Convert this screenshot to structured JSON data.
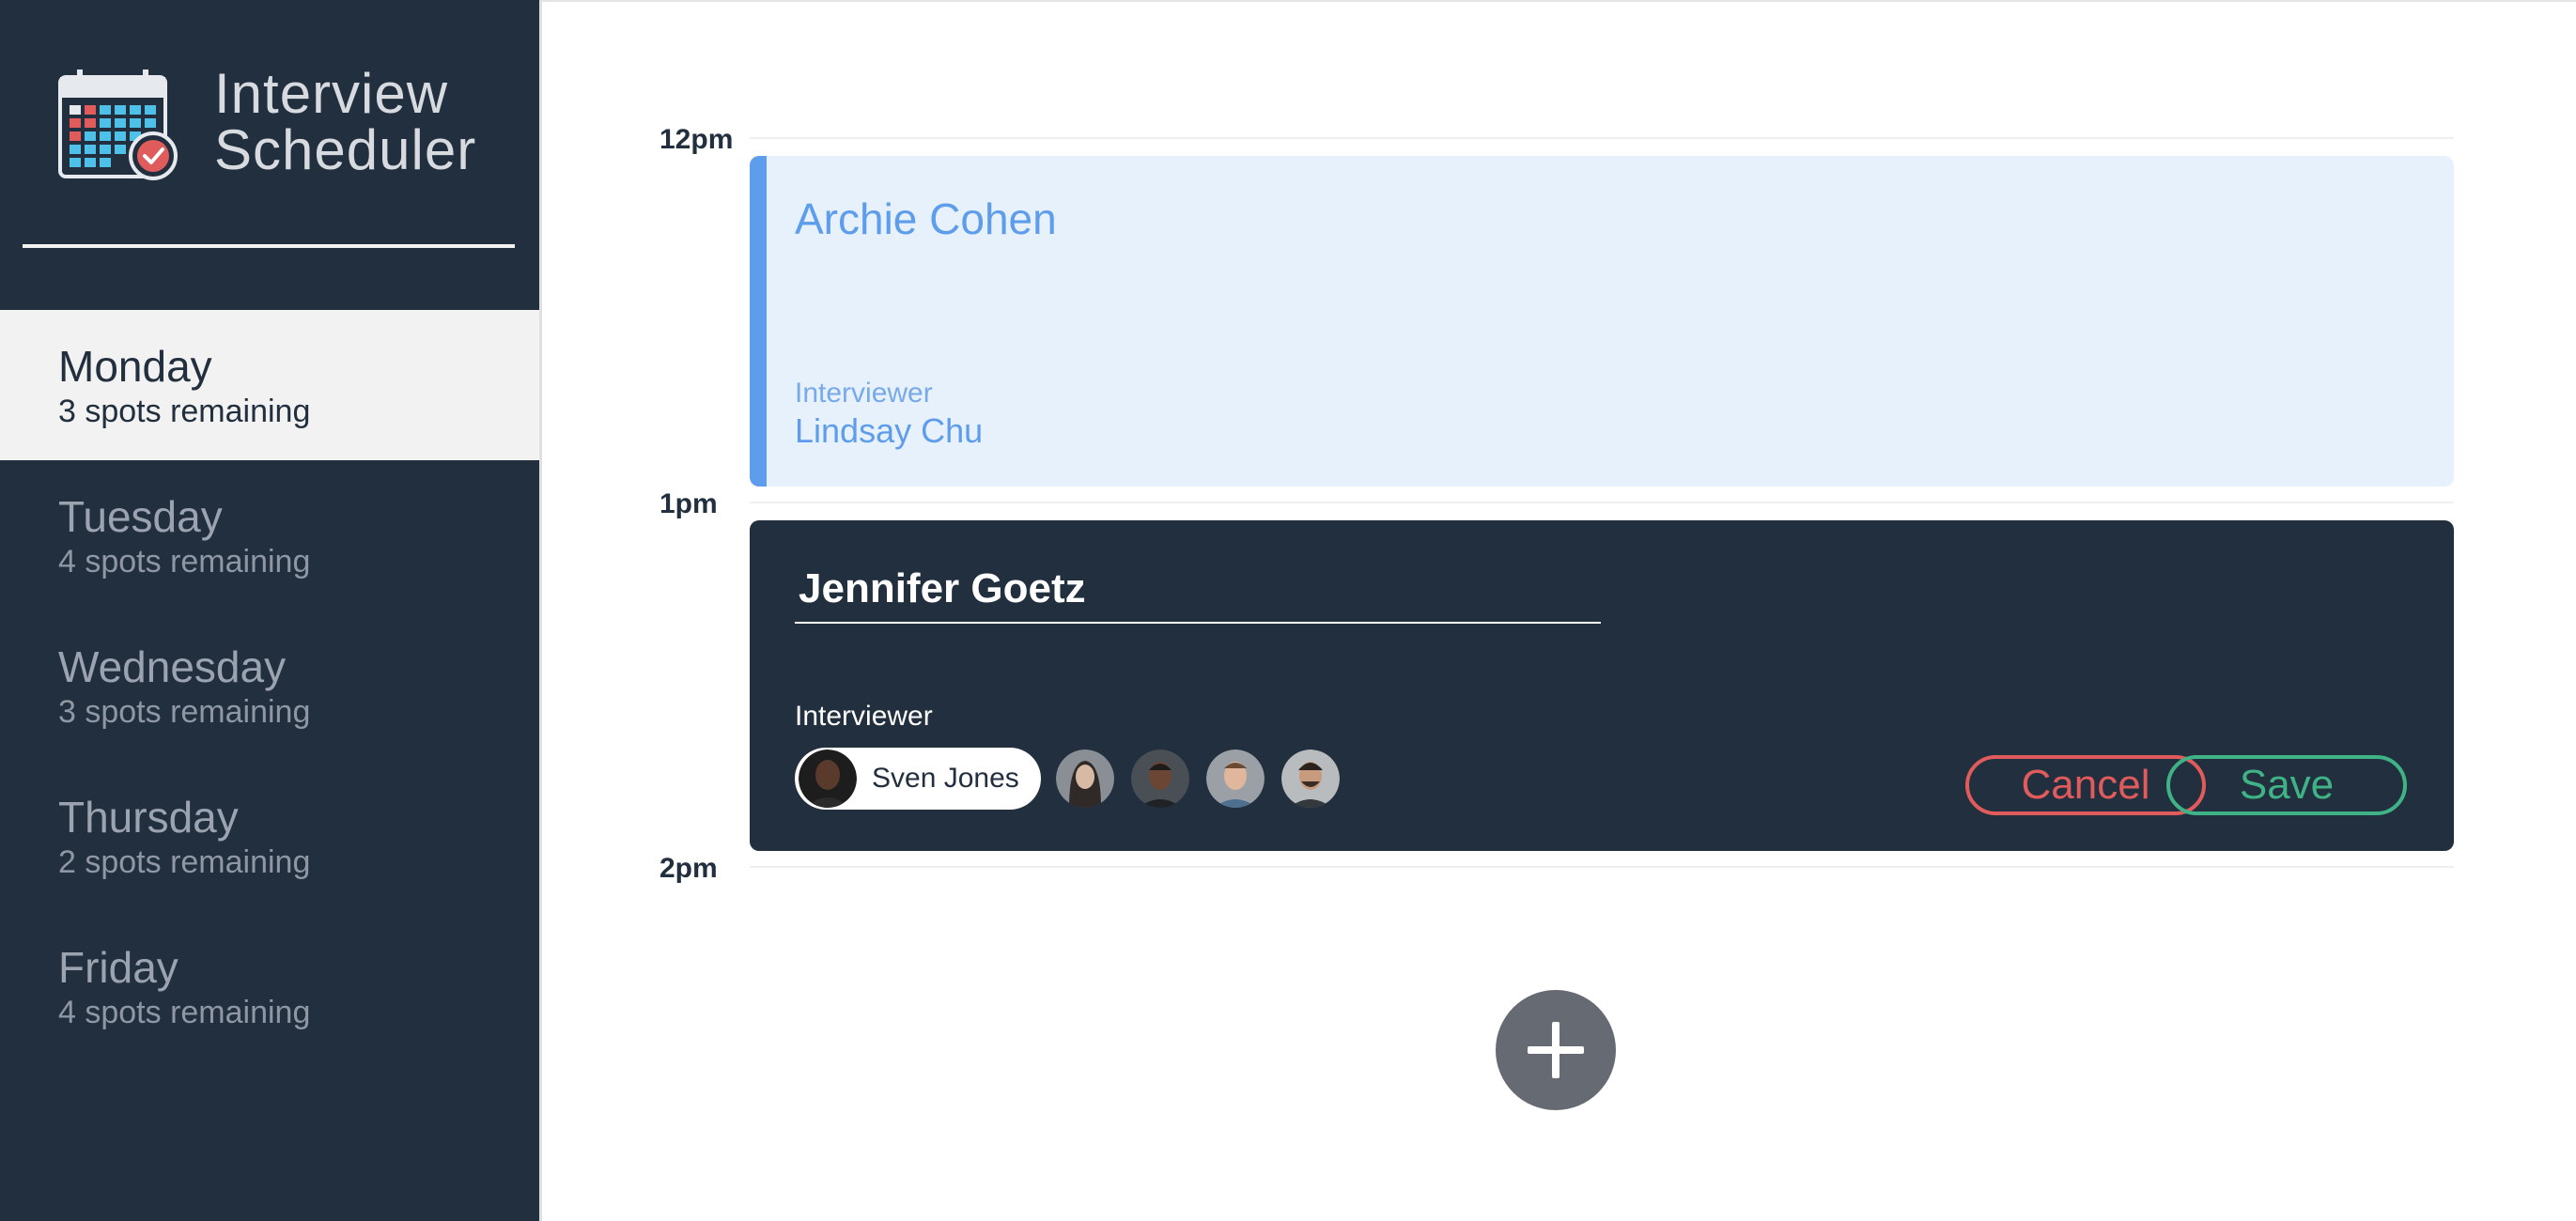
{
  "app": {
    "title_line1": "Interview",
    "title_line2": "Scheduler"
  },
  "days": [
    {
      "name": "Monday",
      "spots": "3 spots remaining",
      "selected": true
    },
    {
      "name": "Tuesday",
      "spots": "4 spots remaining",
      "selected": false
    },
    {
      "name": "Wednesday",
      "spots": "3 spots remaining",
      "selected": false
    },
    {
      "name": "Thursday",
      "spots": "2 spots remaining",
      "selected": false
    },
    {
      "name": "Friday",
      "spots": "4 spots remaining",
      "selected": false
    }
  ],
  "times": [
    "12pm",
    "1pm",
    "2pm"
  ],
  "appointment": {
    "student": "Archie Cohen",
    "interviewer_label": "Interviewer",
    "interviewer": "Lindsay Chu"
  },
  "form": {
    "student_value": "Jennifer Goetz",
    "interviewer_label": "Interviewer",
    "selected_interviewer": "Sven Jones",
    "cancel_label": "Cancel",
    "save_label": "Save"
  },
  "colors": {
    "sidebar_bg": "#222f3e",
    "accent_blue": "#5e9cec",
    "cancel_red": "#e05b5b",
    "save_green": "#3fb386"
  },
  "icons": {
    "logo": "calendar-check-icon",
    "add": "plus-icon"
  }
}
